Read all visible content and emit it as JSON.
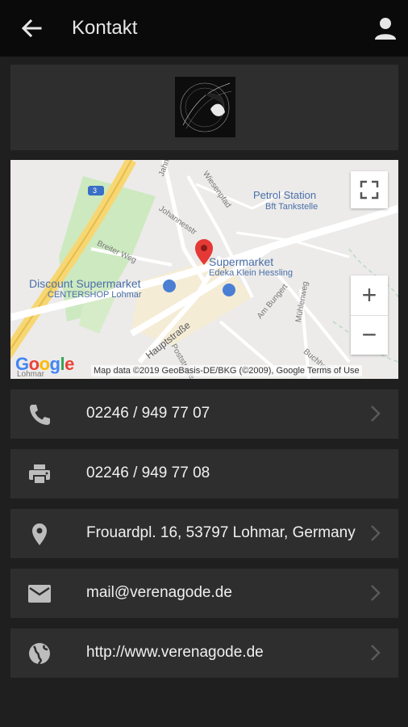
{
  "appbar": {
    "title": "Kontakt",
    "back_icon": "arrow-left-icon",
    "profile_icon": "person-icon"
  },
  "map": {
    "labels": {
      "petrol": "Petrol Station",
      "petrol_sub": "Bft Tankstelle",
      "supermarket": "Supermarket",
      "supermarket_sub": "Edeka Klein Hessling",
      "discount": "Discount Supermarket",
      "discount_sub": "CENTERSHOP Lohmar"
    },
    "streets": {
      "s1": "Jahnstraße",
      "s2": "Wiesenpfad",
      "s3": "Johannesstr",
      "s4": "Breiter Weg",
      "s5": "Hauptstraße",
      "s6": "Poststraße",
      "s7": "Am Bungert",
      "s8": "Mühlenweg",
      "s9": "Buchholz",
      "s10": "Lohmar",
      "s11": "3"
    },
    "attribution": "Map data ©2019 GeoBasis-DE/BKG (©2009), Google   Terms of Use",
    "google_logo": "Google",
    "zoom_in": "+",
    "zoom_out": "−"
  },
  "contacts": [
    {
      "icon": "phone-icon",
      "text": "02246 / 949 77 07",
      "has_chevron": true
    },
    {
      "icon": "printer-icon",
      "text": "02246 / 949 77 08",
      "has_chevron": false
    },
    {
      "icon": "location-pin-icon",
      "text": "Frouardpl. 16, 53797 Lohmar, Germany",
      "has_chevron": true
    },
    {
      "icon": "mail-icon",
      "text": "mail@verenagode.de",
      "has_chevron": true
    },
    {
      "icon": "globe-icon",
      "text": "http://www.verenagode.de",
      "has_chevron": true
    }
  ],
  "colors": {
    "appbar": "#0a0a0a",
    "background": "#1f1f1f",
    "card": "#2e2e2e",
    "pin": "#e53935",
    "map_label": "#4a6fa8"
  }
}
